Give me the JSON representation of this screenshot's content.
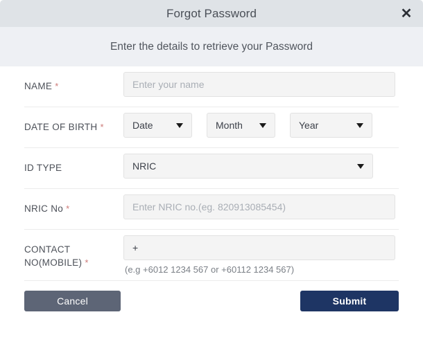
{
  "modal": {
    "title": "Forgot Password",
    "close_icon": "close-icon",
    "subtitle": "Enter the details to retrieve your Password"
  },
  "form": {
    "name": {
      "label": "NAME",
      "required_marker": "*",
      "placeholder": "Enter your name",
      "value": ""
    },
    "dob": {
      "label": "DATE OF BIRTH",
      "required_marker": "*",
      "date": {
        "selected": "Date"
      },
      "month": {
        "selected": "Month"
      },
      "year": {
        "selected": "Year"
      }
    },
    "id_type": {
      "label": "ID TYPE",
      "selected": "NRIC"
    },
    "nric_no": {
      "label": "NRIC No",
      "required_marker": "*",
      "placeholder": "Enter NRIC no.(eg. 820913085454)",
      "value": ""
    },
    "contact": {
      "label_line1": "CONTACT",
      "label_line2": "NO(MOBILE)",
      "required_marker": "*",
      "value": "+",
      "placeholder": "",
      "hint": "(e.g +6012 1234 567 or +60112 1234 567)"
    }
  },
  "footer": {
    "cancel_label": "Cancel",
    "submit_label": "Submit"
  },
  "colors": {
    "header_bg": "#dfe3e7",
    "subtitle_bg": "#eef0f4",
    "cancel_bg": "#5d6576",
    "submit_bg": "#1e3564",
    "required_red": "#cd7a78",
    "input_bg": "#f4f4f4"
  }
}
